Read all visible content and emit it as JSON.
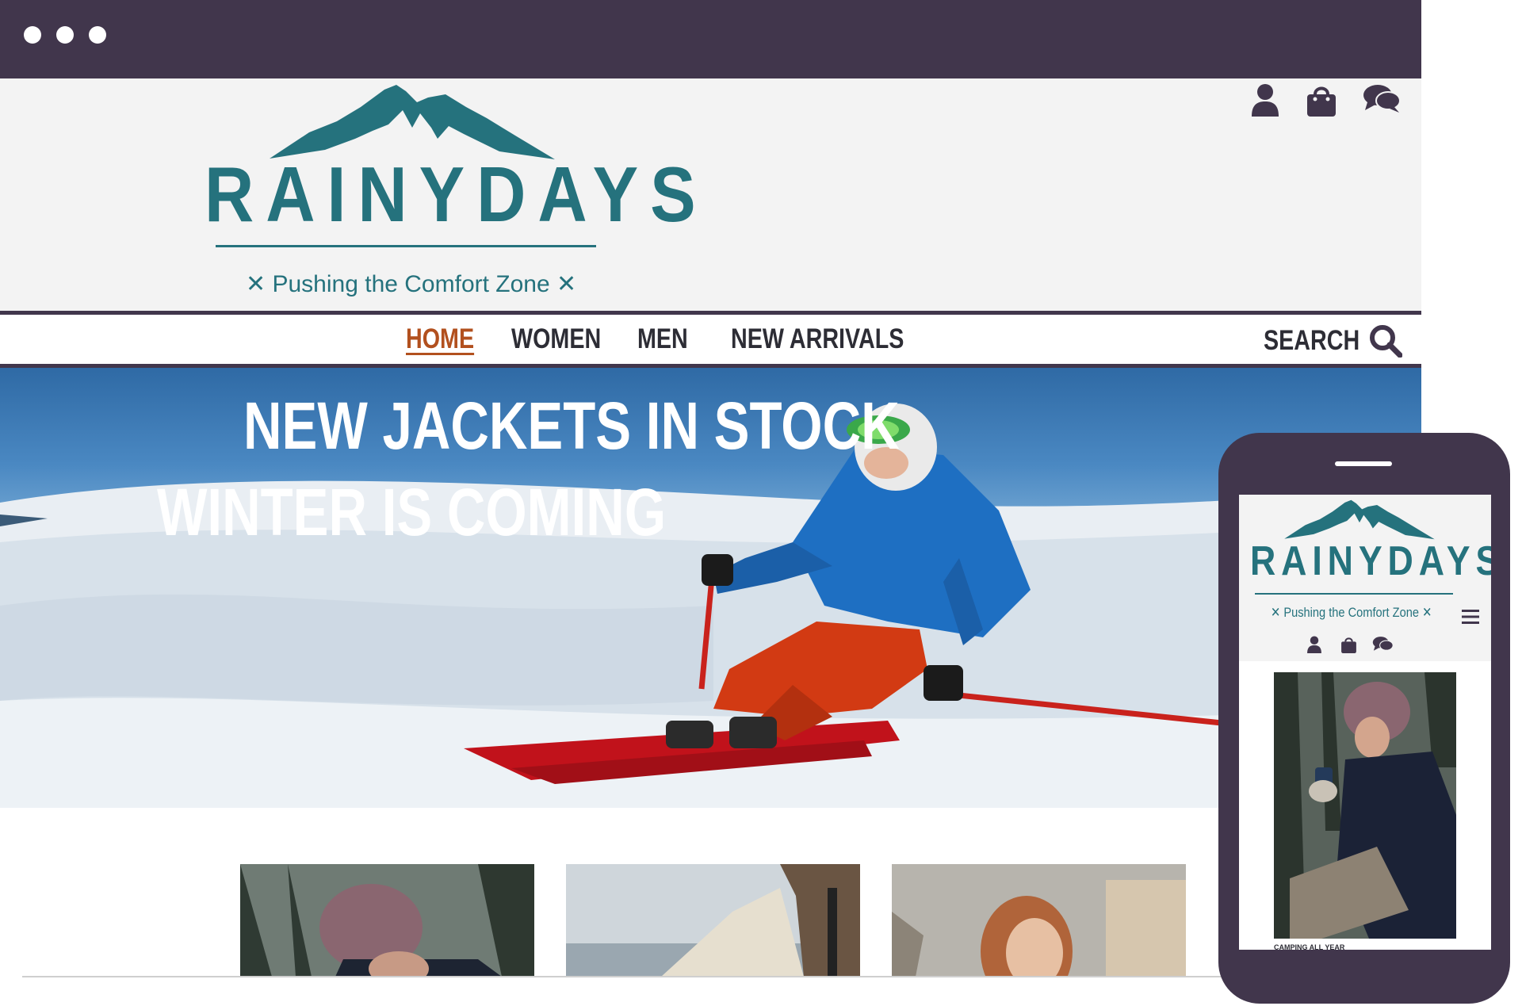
{
  "brand": {
    "name": "RAINYDAYS",
    "tagline": "Pushing the Comfort Zone",
    "tagline_mark": "✕",
    "primary_color": "#25727d",
    "dark_color": "#41364c",
    "accent_color": "#b2501e"
  },
  "header_icons": [
    "user-icon",
    "shopping-bag-icon",
    "chat-icon"
  ],
  "nav": {
    "items": [
      {
        "label": "HOME",
        "active": true
      },
      {
        "label": "WOMEN",
        "active": false
      },
      {
        "label": "MEN",
        "active": false
      },
      {
        "label": "NEW ARRIVALS",
        "active": false
      }
    ],
    "search_label": "SEARCH"
  },
  "hero": {
    "line1": "NEW JACKETS IN STOCK",
    "line2": "WINTER IS COMING"
  },
  "mobile": {
    "menu_icon": "hamburger-menu-icon",
    "caption": "CAMPING ALL YEAR"
  }
}
